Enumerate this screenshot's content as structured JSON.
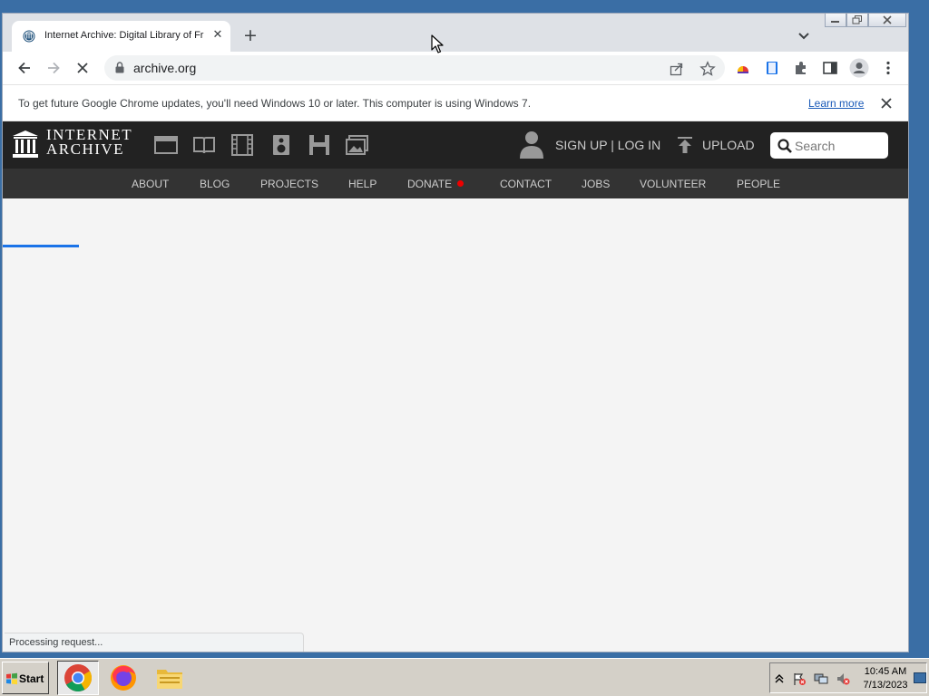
{
  "browser": {
    "tab": {
      "title": "Internet Archive: Digital Library of Free & Borrowable Books, Movies, Music & Wayback Machine",
      "close_icon": "close-icon"
    },
    "new_tab_icon": "plus-icon",
    "address": {
      "url": "archive.org"
    },
    "infobar": {
      "message": "To get future Google Chrome updates, you'll need Windows 10 or later. This computer is using Windows 7.",
      "link": "Learn more"
    },
    "status": "Processing request..."
  },
  "site": {
    "logo_line1": "INTERNET",
    "logo_line2": "ARCHIVE",
    "account": "SIGN UP | LOG IN",
    "upload": "UPLOAD",
    "search_placeholder": "Search",
    "nav": [
      "ABOUT",
      "BLOG",
      "PROJECTS",
      "HELP",
      "DONATE",
      "CONTACT",
      "JOBS",
      "VOLUNTEER",
      "PEOPLE"
    ],
    "donate_dot_color": "#e00000"
  },
  "taskbar": {
    "start": "Start",
    "time": "10:45 AM",
    "date": "7/13/2023"
  },
  "colors": {
    "header_bg": "#222222",
    "nav_bg": "#333333",
    "accent": "#1a73e8"
  }
}
